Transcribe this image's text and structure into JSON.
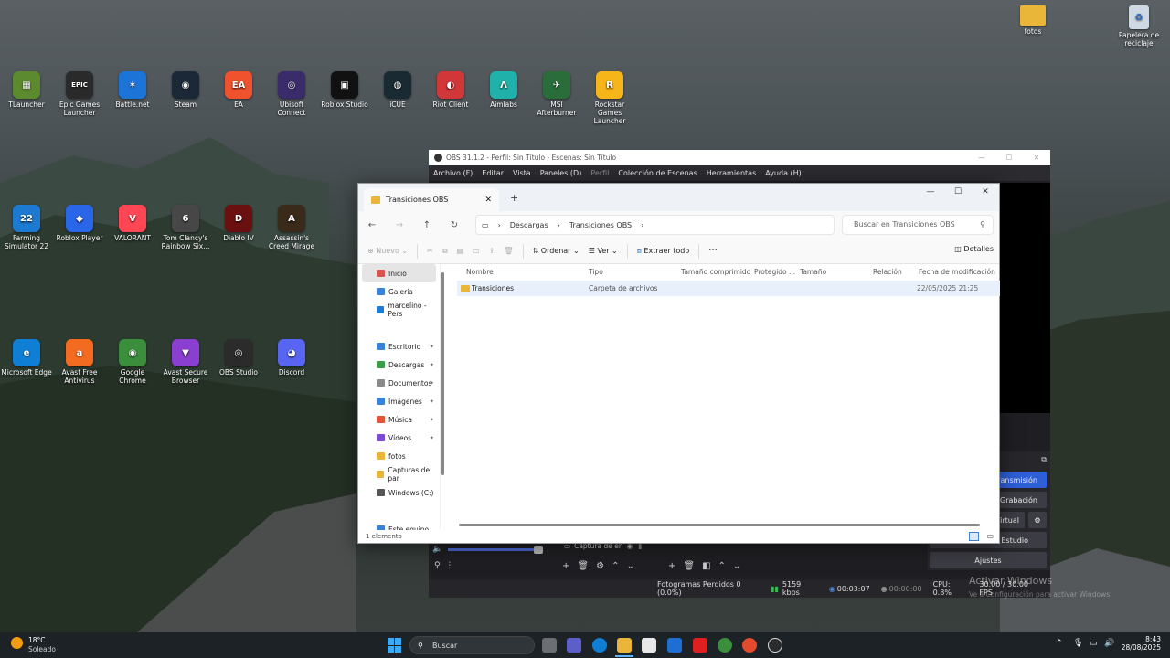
{
  "desktop": {
    "icons": [
      {
        "label": "TLauncher",
        "color": "#5c8a2e",
        "glyph": "▦"
      },
      {
        "label": "Epic Games Launcher",
        "color": "#2a2a2a",
        "glyph": "EPIC"
      },
      {
        "label": "Battle.net",
        "color": "#1d74d8",
        "glyph": "✶"
      },
      {
        "label": "Steam",
        "color": "#1b2838",
        "glyph": "◉"
      },
      {
        "label": "EA",
        "color": "#f0522d",
        "glyph": "EA"
      },
      {
        "label": "Ubisoft Connect",
        "color": "#3a2b6b",
        "glyph": "◎"
      },
      {
        "label": "Roblox Studio",
        "color": "#111111",
        "glyph": "▣"
      },
      {
        "label": "iCUE",
        "color": "#1a2a33",
        "glyph": "◍"
      },
      {
        "label": "Riot Client",
        "color": "#d13639",
        "glyph": "◐"
      },
      {
        "label": "Aimlabs",
        "color": "#20b2aa",
        "glyph": "Λ"
      },
      {
        "label": "MSI Afterburner",
        "color": "#2a6c3a",
        "glyph": "✈"
      },
      {
        "label": "Rockstar Games Launcher",
        "color": "#f6b519",
        "glyph": "R"
      }
    ],
    "icons2": [
      {
        "label": "Farming Simulator 22",
        "color": "#1d7ad1",
        "glyph": "22"
      },
      {
        "label": "Roblox Player",
        "color": "#2a66e8",
        "glyph": "◆"
      },
      {
        "label": "VALORANT",
        "color": "#ff4655",
        "glyph": "V"
      },
      {
        "label": "Tom Clancy's Rainbow Six...",
        "color": "#474747",
        "glyph": "6"
      },
      {
        "label": "Diablo IV",
        "color": "#6a1010",
        "glyph": "D"
      },
      {
        "label": "Assassin's Creed Mirage",
        "color": "#3a2a1a",
        "glyph": "A"
      }
    ],
    "icons3": [
      {
        "label": "Microsoft Edge",
        "color": "#0f7fd6",
        "glyph": "e"
      },
      {
        "label": "Avast Free Antivirus",
        "color": "#f26b21",
        "glyph": "a"
      },
      {
        "label": "Google Chrome",
        "color": "#3b8e3c",
        "glyph": "◉"
      },
      {
        "label": "Avast Secure Browser",
        "color": "#8a3fd1",
        "glyph": "▼"
      },
      {
        "label": "OBS Studio",
        "color": "#2b2b2b",
        "glyph": "◎"
      },
      {
        "label": "Discord",
        "color": "#5865f2",
        "glyph": "◕"
      }
    ],
    "right_icons": [
      {
        "label": "fotos",
        "color": "#e9b63a"
      },
      {
        "label": "Papelera de reciclaje",
        "color": "#cfd9e3"
      }
    ]
  },
  "obs": {
    "title": "OBS 31.1.2 - Perfil: Sin Título - Escenas: Sin Título",
    "menu": [
      "Archivo (F)",
      "Editar",
      "Vista",
      "Paneles (D)",
      "Perfil",
      "Colección de Escenas",
      "Herramientas",
      "Ayuda (H)"
    ],
    "buttons": {
      "stream": "Iniciar Transmisión",
      "record": "Iniciar Grabación",
      "virtual": "Iniciar Cámara Virtual",
      "studio": "Modo de Estudio",
      "settings": "Ajustes"
    },
    "source": "Captura de en",
    "status": {
      "dropped": "Fotogramas Perdidos 0 (0.0%)",
      "kbps": "5159 kbps",
      "time1": "00:03:07",
      "time2": "00:00:00",
      "cpu": "CPU: 0.8%",
      "fps": "30.00 / 30.00 FPS"
    }
  },
  "explorer": {
    "tab_title": "Transiciones OBS",
    "breadcrumb": [
      "Descargas",
      "Transiciones OBS"
    ],
    "search_placeholder": "Buscar en Transiciones OBS",
    "cmd": {
      "new": "Nuevo",
      "sort": "Ordenar",
      "view": "Ver",
      "extract": "Extraer todo",
      "details": "Detalles"
    },
    "sidebar": [
      {
        "label": "Inicio",
        "color": "#d9534f",
        "pin": false,
        "sel": true
      },
      {
        "label": "Galería",
        "color": "#3b82d6",
        "pin": false
      },
      {
        "label": "marcelino - Pers",
        "color": "#1f7ad6",
        "pin": false
      },
      {
        "label": "Escritorio",
        "color": "#3b82d6",
        "pin": true
      },
      {
        "label": "Descargas",
        "color": "#3a9d4a",
        "pin": true
      },
      {
        "label": "Documentos",
        "color": "#8a8a8a",
        "pin": true
      },
      {
        "label": "Imágenes",
        "color": "#3b82d6",
        "pin": true
      },
      {
        "label": "Música",
        "color": "#e2553a",
        "pin": true
      },
      {
        "label": "Vídeos",
        "color": "#7a4bd1",
        "pin": true
      },
      {
        "label": "fotos",
        "color": "#e9b63a",
        "pin": false
      },
      {
        "label": "Capturas de par",
        "color": "#e9b63a",
        "pin": false
      },
      {
        "label": "Windows (C:)",
        "color": "#555555",
        "pin": false
      },
      {
        "label": "Este equipo",
        "color": "#3b82d6",
        "pin": false
      }
    ],
    "columns": [
      "Nombre",
      "Tipo",
      "Tamaño comprimido",
      "Protegido ...",
      "Tamaño",
      "Relación",
      "Fecha de modificación"
    ],
    "rows": [
      {
        "name": "Transiciones",
        "type": "Carpeta de archivos",
        "date": "22/05/2025 21:25"
      }
    ],
    "status": "1 elemento"
  },
  "taskbar": {
    "weather_temp": "18°C",
    "weather_desc": "Soleado",
    "search": "Buscar",
    "time": "8:43",
    "date": "28/08/2025"
  },
  "watermark": {
    "line1": "Activar Windows",
    "line2": "Ve a Configuración para activar Windows."
  }
}
